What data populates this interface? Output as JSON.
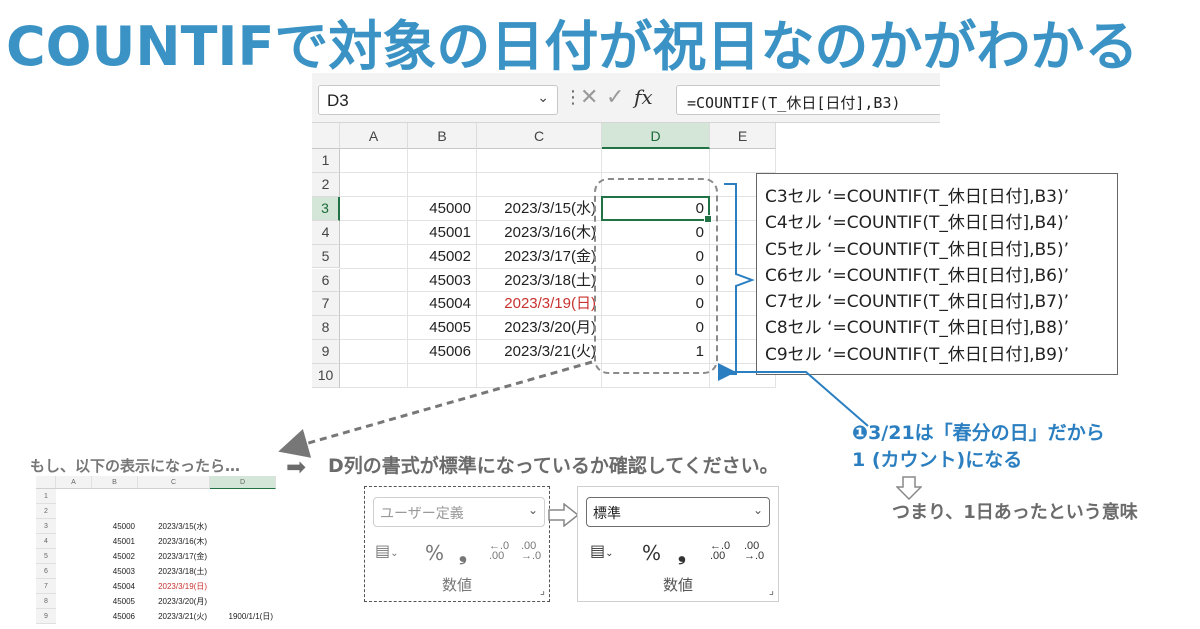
{
  "title": "COUNTIFで対象の日付が祝日なのかがわかる",
  "excel": {
    "name_box": "D3",
    "formula_bar_icons": [
      "more-icon",
      "cancel-icon",
      "enter-icon",
      "fx-icon"
    ],
    "fx_label": "fx",
    "formula": "=COUNTIF(T_休日[日付],B3)",
    "columns": [
      "A",
      "B",
      "C",
      "D",
      "E"
    ],
    "selected_column": "D",
    "rows": [
      {
        "num": "1",
        "b": "",
        "c": "",
        "d": ""
      },
      {
        "num": "2",
        "b": "",
        "c": "",
        "d": ""
      },
      {
        "num": "3",
        "b": "45000",
        "c": "2023/3/15(水)",
        "d": "0"
      },
      {
        "num": "4",
        "b": "45001",
        "c": "2023/3/16(木)",
        "d": "0"
      },
      {
        "num": "5",
        "b": "45002",
        "c": "2023/3/17(金)",
        "d": "0"
      },
      {
        "num": "6",
        "b": "45003",
        "c": "2023/3/18(土)",
        "d": "0"
      },
      {
        "num": "7",
        "b": "45004",
        "c": "2023/3/19(日)",
        "d": "0",
        "highlight": "#c8322f"
      },
      {
        "num": "8",
        "b": "45005",
        "c": "2023/3/20(月)",
        "d": "0"
      },
      {
        "num": "9",
        "b": "45006",
        "c": "2023/3/21(火)",
        "d": "1"
      },
      {
        "num": "10",
        "b": "",
        "c": "",
        "d": ""
      }
    ]
  },
  "callout": [
    "C3セル ‘=COUNTIF(T_休日[日付],B3)’",
    "C4セル ‘=COUNTIF(T_休日[日付],B4)’",
    "C5セル ‘=COUNTIF(T_休日[日付],B5)’",
    "C6セル ‘=COUNTIF(T_休日[日付],B6)’",
    "C7セル ‘=COUNTIF(T_休日[日付],B7)’",
    "C8セル ‘=COUNTIF(T_休日[日付],B8)’",
    "C9セル ‘=COUNTIF(T_休日[日付],B9)’"
  ],
  "note_blue": [
    "❶3/21は「春分の日」だから",
    " 1 (カウント)になる"
  ],
  "note_if": "もし、以下の表示になったら…",
  "note_check": "D列の書式が標準になっているか確認してください。",
  "note_meaning": "つまり、1日あったという意味",
  "small_excel": {
    "columns": [
      "A",
      "B",
      "C",
      "D"
    ],
    "rows": [
      {
        "num": "1",
        "b": "",
        "c": "",
        "d": ""
      },
      {
        "num": "2",
        "b": "",
        "c": "",
        "d": ""
      },
      {
        "num": "3",
        "b": "45000",
        "c": "2023/3/15(水)",
        "d": ""
      },
      {
        "num": "4",
        "b": "45001",
        "c": "2023/3/16(木)",
        "d": ""
      },
      {
        "num": "5",
        "b": "45002",
        "c": "2023/3/17(金)",
        "d": ""
      },
      {
        "num": "6",
        "b": "45003",
        "c": "2023/3/18(土)",
        "d": ""
      },
      {
        "num": "7",
        "b": "45004",
        "c": "2023/3/19(日)",
        "d": "",
        "highlight": "#c8322f"
      },
      {
        "num": "8",
        "b": "45005",
        "c": "2023/3/20(月)",
        "d": ""
      },
      {
        "num": "9",
        "b": "45006",
        "c": "2023/3/21(火)",
        "d": "1900/1/1(日)"
      }
    ]
  },
  "number_panels": [
    {
      "format": "ユーザー定義",
      "label": "数値",
      "state": "before"
    },
    {
      "format": "標準",
      "label": "数値",
      "state": "after"
    }
  ],
  "panel_icons": [
    "accounting-format-icon",
    "percent-icon",
    "comma-style-icon",
    "increase-decimal-icon",
    "decrease-decimal-icon"
  ],
  "panel_icon_text": {
    "percent": "%",
    "comma": "❟",
    "inc_top": "←.0",
    "inc_bottom": ".00",
    "dec_top": ".00",
    "dec_bottom": "→.0"
  },
  "colors": {
    "title": "#3a93c4",
    "accent_blue": "#2b7fc0",
    "grey_text": "#6b6b6b",
    "excel_green": "#217346"
  }
}
